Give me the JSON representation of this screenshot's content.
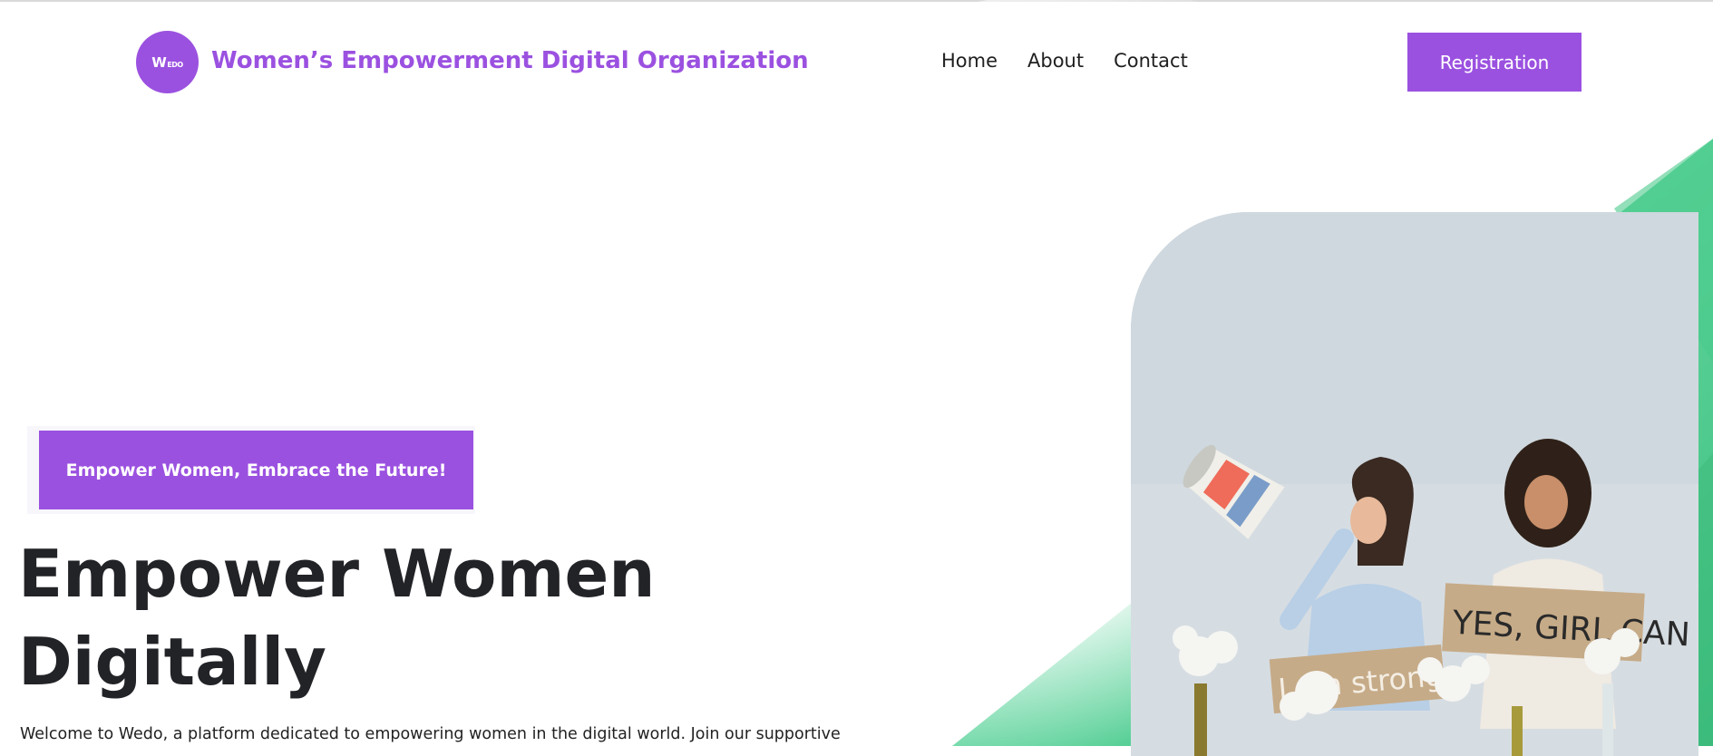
{
  "header": {
    "logo_text": "W",
    "logo_small": "EDO",
    "brand_name": "Women’s Empowerment Digital Organization",
    "nav": [
      {
        "label": "Home"
      },
      {
        "label": "About"
      },
      {
        "label": "Contact"
      }
    ],
    "cta_label": "Registration"
  },
  "hero": {
    "tagline": "Empower Women, Embrace the Future!",
    "headline_line1": "Empower Women",
    "headline_line2": "Digitally",
    "intro": "Welcome to Wedo, a platform dedicated to empowering women in the digital world. Join our supportive",
    "photo": {
      "sign_left": "I am strong",
      "sign_right": "YES, GIRL CAN"
    }
  },
  "colors": {
    "accent": "#9b51e0",
    "green": "#4ccf8e",
    "text": "#222327"
  }
}
